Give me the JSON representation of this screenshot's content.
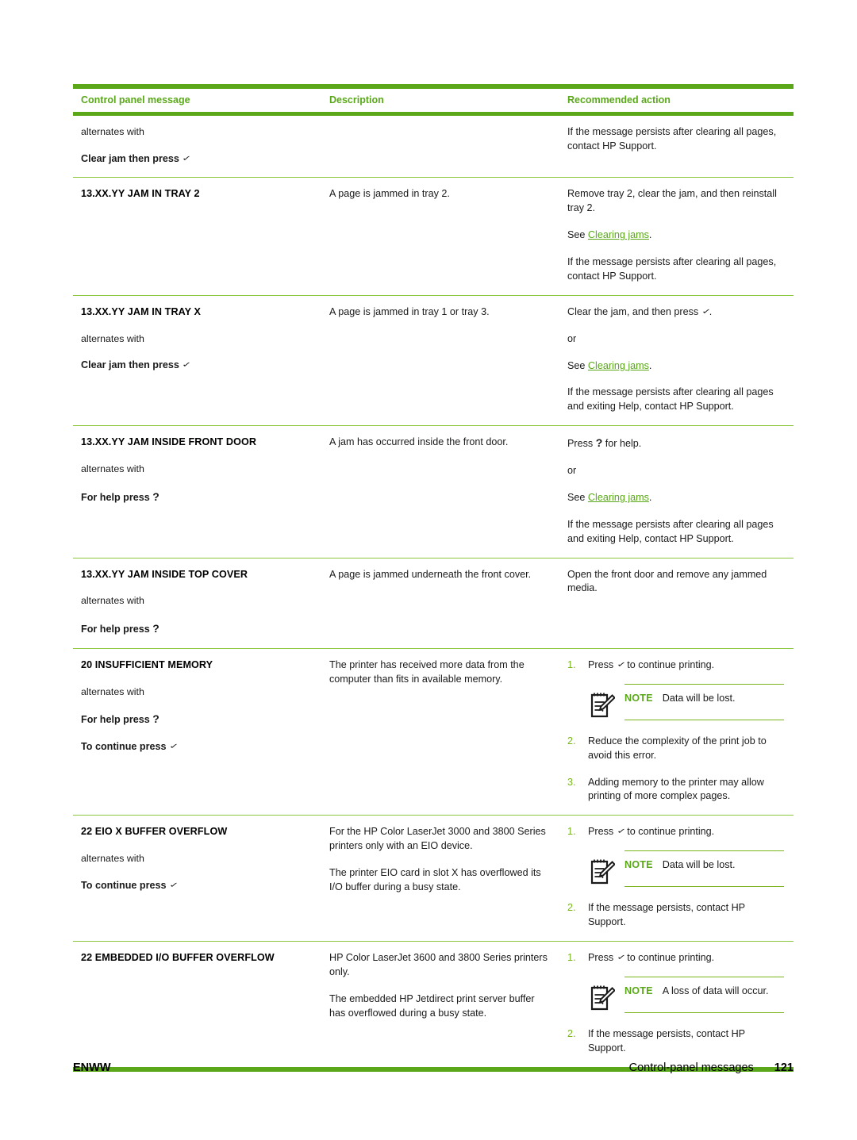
{
  "document": {
    "table_headers": {
      "col1": "Control panel message",
      "col2": "Description",
      "col3": "Recommended action"
    },
    "accent_color": "#5aa81a",
    "link_color": "#5aa81a",
    "rows": [
      {
        "id": "row-continued-jam",
        "message": {
          "title": "",
          "alternates_label": "alternates with",
          "alt_message": "Clear jam then press",
          "alt_glyph": "check-icon"
        },
        "description": [],
        "action": [
          "If the message persists after clearing all pages, contact HP Support."
        ]
      },
      {
        "id": "row-jam-tray-2",
        "message": {
          "title": "13.XX.YY JAM IN TRAY 2"
        },
        "description": [
          "A page is jammed in tray 2."
        ],
        "action": [
          "Remove tray 2, clear the jam, and then reinstall tray 2.",
          "See Clearing jams.",
          "If the message persists after clearing all pages, contact HP Support."
        ],
        "action_link": "Clearing jams"
      },
      {
        "id": "row-jam-tray-x",
        "message": {
          "title": "13.XX.YY JAM IN TRAY X",
          "alternates_label": "alternates with",
          "alt_message": "Clear jam then press",
          "alt_glyph": "check-icon"
        },
        "description": [
          "A page is jammed in tray 1 or tray 3."
        ],
        "action": [
          "Clear the jam, and then press ✓.",
          "or",
          "See Clearing jams.",
          "If the message persists after clearing all pages and exiting Help, contact HP Support."
        ],
        "action_link": "Clearing jams"
      },
      {
        "id": "row-jam-front-door",
        "message": {
          "title": "13.XX.YY JAM INSIDE FRONT DOOR",
          "alternates_label": "alternates with",
          "alt_message": "For help press",
          "alt_glyph": "question-icon"
        },
        "description": [
          "A jam has occurred inside the front door."
        ],
        "action": [
          "Press ? for help.",
          "or",
          "See Clearing jams.",
          "If the message persists after clearing all pages and exiting Help, contact HP Support."
        ],
        "action_link": "Clearing jams"
      },
      {
        "id": "row-jam-top-cover",
        "message": {
          "title": "13.XX.YY JAM INSIDE TOP COVER",
          "alternates_label": "alternates with",
          "alt_message": "For help press",
          "alt_glyph": "question-icon"
        },
        "description": [
          "A page is jammed underneath the front cover."
        ],
        "action": [
          "Open the front door and remove any jammed media."
        ]
      },
      {
        "id": "row-insufficient-memory",
        "message": {
          "title": "20 INSUFFICIENT MEMORY",
          "alternates_label": "alternates with",
          "alt_message": "For help press",
          "alt_glyph": "question-icon",
          "alt_message_2": "To continue press",
          "alt_glyph_2": "check-icon"
        },
        "description": [
          "The printer has received more data from the computer than fits in available memory."
        ],
        "steps": [
          {
            "num": "1.",
            "text": "Press ✓ to continue printing."
          },
          {
            "num": "2.",
            "text": "Reduce the complexity of the print job to avoid this error."
          },
          {
            "num": "3.",
            "text": "Adding memory to the printer may allow printing of more complex pages."
          }
        ],
        "note": {
          "label": "NOTE",
          "text": "Data will be lost.",
          "after_step": 1
        }
      },
      {
        "id": "row-eio-buffer-overflow",
        "message": {
          "title": "22 EIO X BUFFER OVERFLOW",
          "alternates_label": "alternates with",
          "alt_message": "To continue press",
          "alt_glyph": "check-icon"
        },
        "description": [
          "For the HP Color LaserJet 3000 and 3800 Series printers only with an EIO device.",
          "The printer EIO card in slot X has overflowed its I/O buffer during a busy state."
        ],
        "steps": [
          {
            "num": "1.",
            "text": "Press ✓ to continue printing."
          },
          {
            "num": "2.",
            "text": "If the message persists, contact HP Support."
          }
        ],
        "note": {
          "label": "NOTE",
          "text": "Data will be lost.",
          "after_step": 1
        }
      },
      {
        "id": "row-embedded-io-buffer-overflow",
        "message": {
          "title": "22 EMBEDDED I/O BUFFER OVERFLOW"
        },
        "description": [
          "HP Color LaserJet 3600 and 3800 Series printers only.",
          "The embedded HP Jetdirect print server buffer has overflowed during a busy state."
        ],
        "steps": [
          {
            "num": "1.",
            "text": "Press ✓ to continue printing."
          },
          {
            "num": "2.",
            "text": "If the message persists, contact HP Support."
          }
        ],
        "note": {
          "label": "NOTE",
          "text": "A loss of data will occur.",
          "after_step": 1
        }
      }
    ]
  },
  "footer": {
    "left": "ENWW",
    "chapter": "Control-panel messages",
    "page_number": "121"
  }
}
